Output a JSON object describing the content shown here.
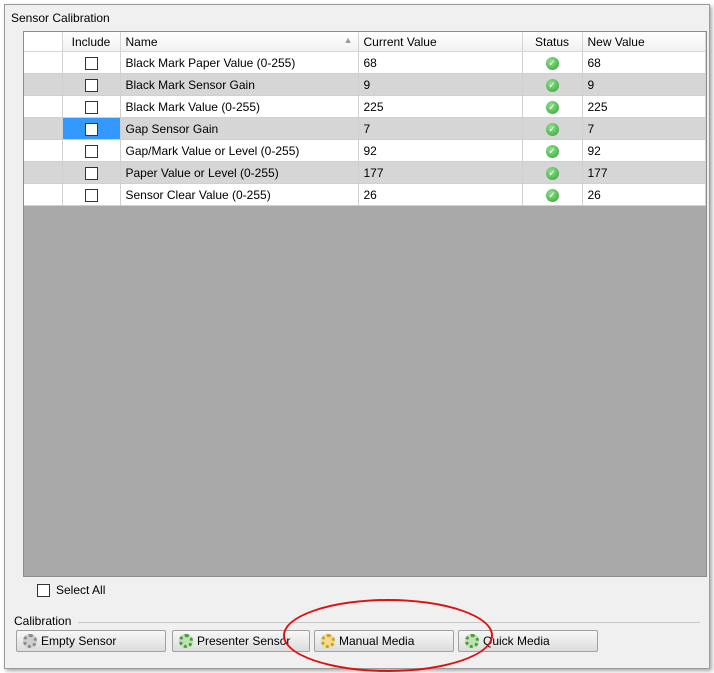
{
  "section_title": "Sensor Calibration",
  "table": {
    "headers": {
      "include": "Include",
      "name": "Name",
      "current_value": "Current Value",
      "status": "Status",
      "new_value": "New Value"
    },
    "rows": [
      {
        "name": "Black Mark Paper Value (0-255)",
        "current": "68",
        "status": "ok",
        "new": "68"
      },
      {
        "name": "Black Mark Sensor Gain",
        "current": "9",
        "status": "ok",
        "new": "9"
      },
      {
        "name": "Black Mark Value (0-255)",
        "current": "225",
        "status": "ok",
        "new": "225"
      },
      {
        "name": "Gap Sensor Gain",
        "current": "7",
        "status": "ok",
        "new": "7"
      },
      {
        "name": "Gap/Mark Value or Level (0-255)",
        "current": "92",
        "status": "ok",
        "new": "92"
      },
      {
        "name": "Paper Value or Level (0-255)",
        "current": "177",
        "status": "ok",
        "new": "177"
      },
      {
        "name": "Sensor Clear Value (0-255)",
        "current": "26",
        "status": "ok",
        "new": "26"
      }
    ]
  },
  "select_all_label": "Select All",
  "calibration": {
    "label": "Calibration",
    "buttons": [
      {
        "label": "Empty Sensor",
        "icon": "gear-icon"
      },
      {
        "label": "Presenter Sensor",
        "icon": "gear-green-icon"
      },
      {
        "label": "Manual Media",
        "icon": "gear-yellow-icon"
      },
      {
        "label": "Quick Media",
        "icon": "gear-green-icon"
      }
    ]
  },
  "colors": {
    "row_alt": "#d6d6d6",
    "selection": "#3399ff",
    "status_ok": "#2ea12e",
    "highlight": "#e01010"
  }
}
